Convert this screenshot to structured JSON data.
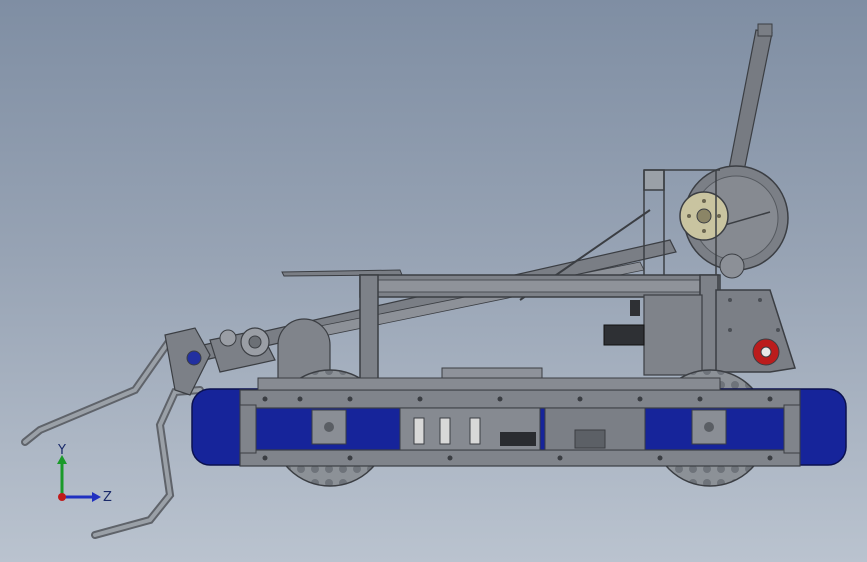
{
  "viewport": {
    "background_top": "#7f8ea3",
    "background_bottom": "#bac3cf"
  },
  "model": {
    "frame_color": "#6c7076",
    "plate_color": "#7c8086",
    "track_color": "#15259a",
    "wheel_color": "#8a8f95",
    "accent_color": "#c21a1a"
  },
  "triad": {
    "y_label": "Y",
    "z_label": "Z",
    "y_color": "#1a9a2a",
    "z_color": "#2030c0",
    "x_color": "#c01a1a"
  }
}
